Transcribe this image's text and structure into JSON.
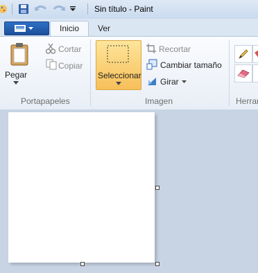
{
  "window": {
    "title": "Sin título - Paint"
  },
  "tabs": [
    {
      "label": "Inicio",
      "selected": true
    },
    {
      "label": "Ver",
      "selected": false
    }
  ],
  "clipboard": {
    "paste_label": "Pegar",
    "cut_label": "Cortar",
    "copy_label": "Copiar",
    "group_label": "Portapapeles"
  },
  "image": {
    "select_label": "Seleccionar",
    "crop_label": "Recortar",
    "resize_label": "Cambiar tamaño",
    "rotate_label": "Girar",
    "group_label": "Imagen"
  },
  "tools": {
    "group_label": "Herrar"
  },
  "colors": {
    "accent": "#1d4f9a",
    "select_highlight": "#f7bf5a"
  }
}
